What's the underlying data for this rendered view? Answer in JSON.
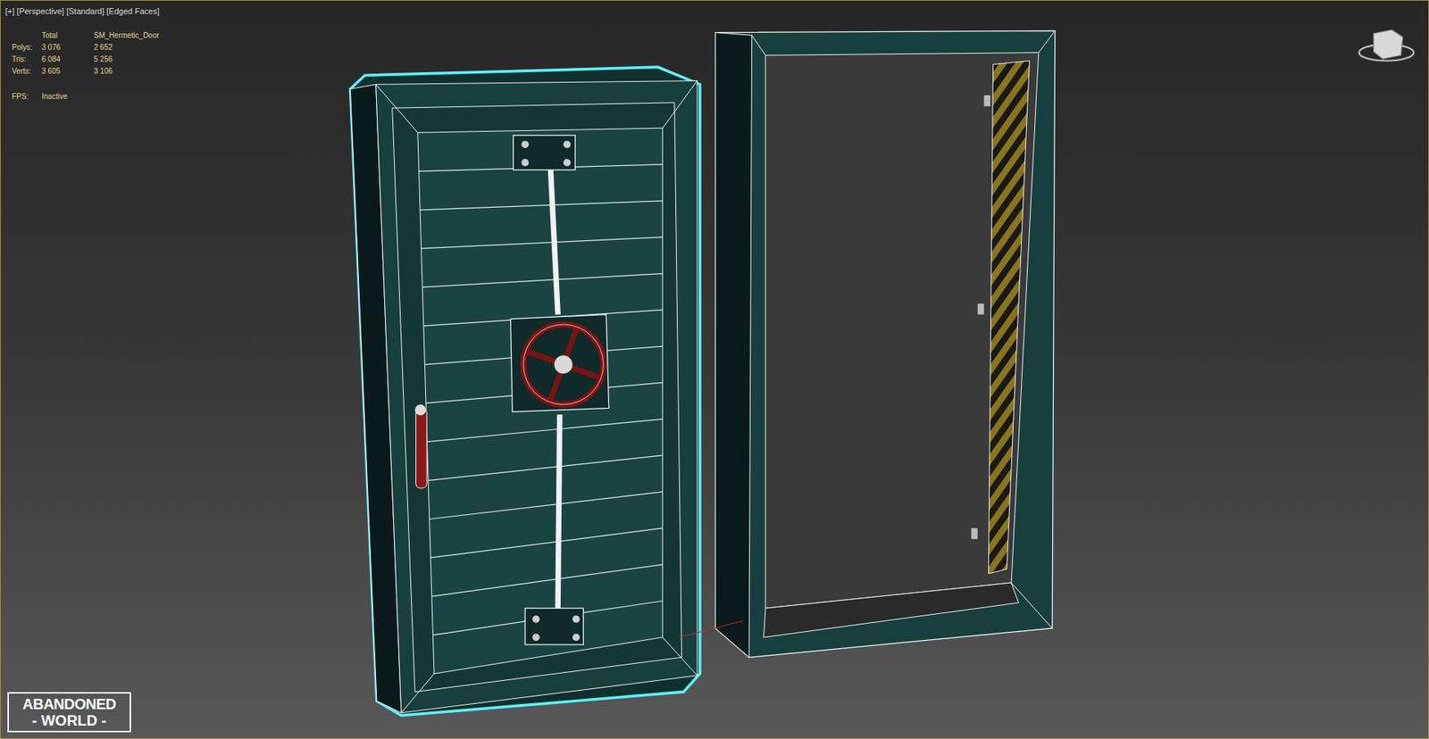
{
  "viewport": {
    "label": "[+] [Perspective] [Standard] [Edged Faces]"
  },
  "stats": {
    "columns": [
      "Total",
      "SM_Hermetic_Door"
    ],
    "rows": [
      {
        "label": "Polys:",
        "total": "3 076",
        "object": "2 652"
      },
      {
        "label": "Tris:",
        "total": "6 084",
        "object": "5 256"
      },
      {
        "label": "Verts:",
        "total": "3 605",
        "object": "3 106"
      }
    ],
    "fps": {
      "label": "FPS:",
      "value": "Inactive"
    }
  },
  "scene": {
    "objects": [
      {
        "name": "door",
        "selected": true
      },
      {
        "name": "frame",
        "selected": false
      }
    ]
  },
  "logo": {
    "line1": "ABANDONED",
    "line2": "- WORLD -"
  }
}
